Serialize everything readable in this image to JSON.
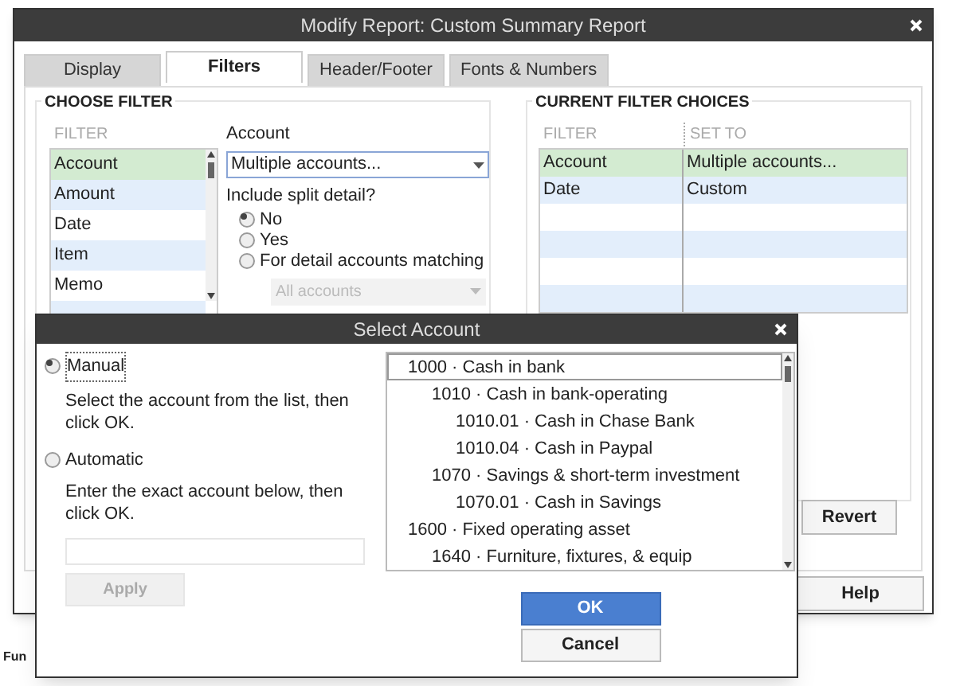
{
  "background": {
    "fragments": [
      "Fun"
    ]
  },
  "main_window": {
    "title": "Modify Report: Custom Summary Report",
    "tabs": [
      {
        "label": "Display",
        "selected": false
      },
      {
        "label": "Filters",
        "selected": true
      },
      {
        "label": "Header/Footer",
        "selected": false
      },
      {
        "label": "Fonts & Numbers",
        "selected": false
      }
    ],
    "choose_filter": {
      "heading": "CHOOSE FILTER",
      "list_header": "FILTER",
      "filters": [
        {
          "label": "Account",
          "selected": true
        },
        {
          "label": "Amount",
          "selected": false
        },
        {
          "label": "Date",
          "selected": false
        },
        {
          "label": "Item",
          "selected": false
        },
        {
          "label": "Memo",
          "selected": false
        }
      ],
      "account_label": "Account",
      "account_value": "Multiple accounts...",
      "split_label": "Include split detail?",
      "split_options": [
        {
          "label": "No",
          "selected": true
        },
        {
          "label": "Yes",
          "selected": false
        },
        {
          "label": "For detail accounts matching",
          "selected": false
        }
      ],
      "detail_accounts": {
        "value": "All accounts",
        "disabled": true
      }
    },
    "current_filters": {
      "heading": "CURRENT FILTER CHOICES",
      "columns": [
        "FILTER",
        "SET TO"
      ],
      "rows": [
        {
          "filter": "Account",
          "set_to": "Multiple accounts...",
          "selected": true
        },
        {
          "filter": "Date",
          "set_to": "Custom",
          "selected": false
        }
      ]
    },
    "buttons": [
      {
        "label": "Revert",
        "kind": "revert"
      },
      {
        "label": "Help",
        "kind": "help"
      }
    ]
  },
  "select_account": {
    "title": "Select Account",
    "modes": [
      {
        "label": "Manual",
        "selected": true,
        "hint": "Select the account from the list, then click OK."
      },
      {
        "label": "Automatic",
        "selected": false,
        "hint": "Enter the exact account below, then click OK."
      }
    ],
    "apply_button": {
      "label": "Apply",
      "disabled": true
    },
    "accounts": [
      {
        "label": "1000 · Cash in bank",
        "selected": true,
        "children": [
          {
            "label": "1010 · Cash in bank-operating",
            "selected": false,
            "children": [
              {
                "label": "1010.01 · Cash in Chase Bank",
                "selected": false
              },
              {
                "label": "1010.04 · Cash in Paypal",
                "selected": false
              }
            ]
          },
          {
            "label": "1070 · Savings & short-term investment",
            "selected": false,
            "children": [
              {
                "label": "1070.01 · Cash in Savings",
                "selected": false
              }
            ]
          }
        ]
      },
      {
        "label": "1600 · Fixed operating asset",
        "selected": false,
        "children": [
          {
            "label": "1640 · Furniture, fixtures, & equip",
            "selected": false
          }
        ]
      }
    ],
    "buttons": [
      {
        "label": "OK",
        "kind": "primary"
      },
      {
        "label": "Cancel",
        "kind": "secondary"
      }
    ]
  }
}
